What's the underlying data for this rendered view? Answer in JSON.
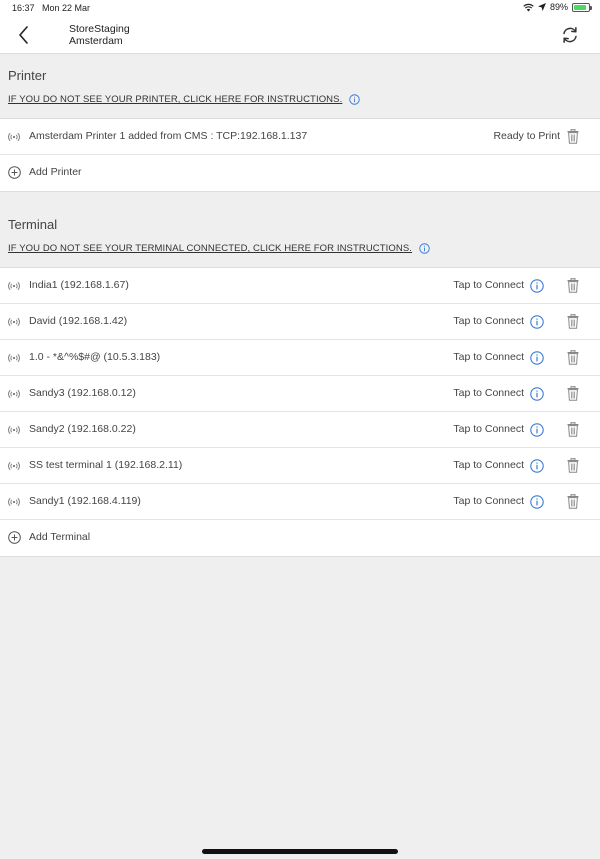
{
  "status_bar": {
    "time": "16:37",
    "date": "Mon 22 Mar",
    "battery": "89%",
    "battery_level": 0.89
  },
  "header": {
    "store_name": "StoreStaging",
    "location": "Amsterdam"
  },
  "printer_section": {
    "title": "Printer",
    "instructions": "IF YOU DO NOT SEE YOUR PRINTER, CLICK HERE FOR INSTRUCTIONS.",
    "printers": [
      {
        "name": "Amsterdam Printer 1 added from CMS : TCP:192.168.1.137",
        "status": "Ready to Print"
      }
    ],
    "add_label": "Add Printer"
  },
  "terminal_section": {
    "title": "Terminal",
    "instructions": "IF YOU DO NOT SEE YOUR TERMINAL CONNECTED, CLICK HERE FOR INSTRUCTIONS.",
    "terminals": [
      {
        "name": "India1 (192.168.1.67)",
        "status": "Tap to Connect"
      },
      {
        "name": "David (192.168.1.42)",
        "status": "Tap to Connect"
      },
      {
        "name": "1.0 - *&^%$#@ (10.5.3.183)",
        "status": "Tap to Connect"
      },
      {
        "name": "Sandy3 (192.168.0.12)",
        "status": "Tap to Connect"
      },
      {
        "name": "Sandy2 (192.168.0.22)",
        "status": "Tap to Connect"
      },
      {
        "name": "SS test terminal 1 (192.168.2.11)",
        "status": "Tap to Connect"
      },
      {
        "name": "Sandy1 (192.168.4.119)",
        "status": "Tap to Connect"
      }
    ],
    "add_label": "Add Terminal"
  },
  "colors": {
    "accent_blue": "#3a7bd5",
    "background": "#efefef",
    "row_background": "#ffffff"
  }
}
